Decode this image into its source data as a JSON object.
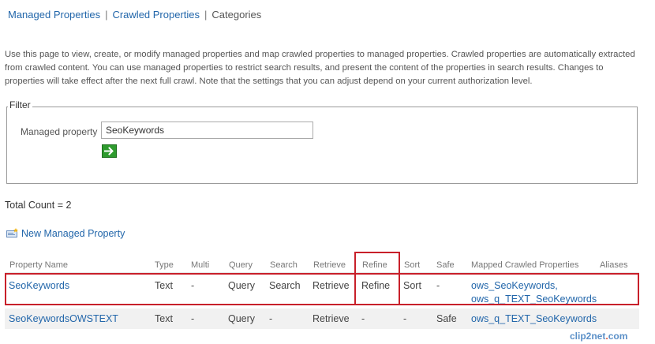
{
  "nav": {
    "managed_properties": "Managed Properties",
    "crawled_properties": "Crawled Properties",
    "categories": "Categories",
    "separator": "|"
  },
  "description": "Use this page to view, create, or modify managed properties and map crawled properties to managed properties. Crawled properties are automatically extracted from crawled content. You can use managed properties to restrict search results, and present the content of the properties in search results. Changes to properties will take effect after the next full crawl. Note that the settings that you can adjust depend on your current authorization level.",
  "filter": {
    "legend": "Filter",
    "label": "Managed property",
    "value": "SeoKeywords",
    "go_icon": "arrow-right-icon"
  },
  "total_count": "Total Count = 2",
  "new_property": {
    "label": "New Managed Property",
    "icon": "new-item-icon"
  },
  "table": {
    "headers": [
      "Property Name",
      "Type",
      "Multi",
      "Query",
      "Search",
      "Retrieve",
      "Refine",
      "Sort",
      "Safe",
      "Mapped Crawled Properties",
      "Aliases"
    ],
    "rows": [
      {
        "name": "SeoKeywords",
        "type": "Text",
        "multi": "-",
        "query": "Query",
        "search": "Search",
        "retrieve": "Retrieve",
        "refine": "Refine",
        "sort": "Sort",
        "safe": "-",
        "mapped_1": "ows_SeoKeywords,",
        "mapped_2": "ows_q_TEXT_SeoKeywords",
        "aliases": ""
      },
      {
        "name": "SeoKeywordsOWSTEXT",
        "type": "Text",
        "multi": "-",
        "query": "Query",
        "search": "-",
        "retrieve": "Retrieve",
        "refine": "-",
        "sort": "-",
        "safe": "Safe",
        "mapped_1": "ows_q_TEXT_SeoKeywords",
        "mapped_2": "",
        "aliases": ""
      }
    ]
  },
  "watermark": {
    "left": "clip2net",
    "dot": ".",
    "right": "com"
  },
  "colors": {
    "link": "#2266aa",
    "highlight": "#c8202a",
    "go_button": "#2e9b2e"
  }
}
